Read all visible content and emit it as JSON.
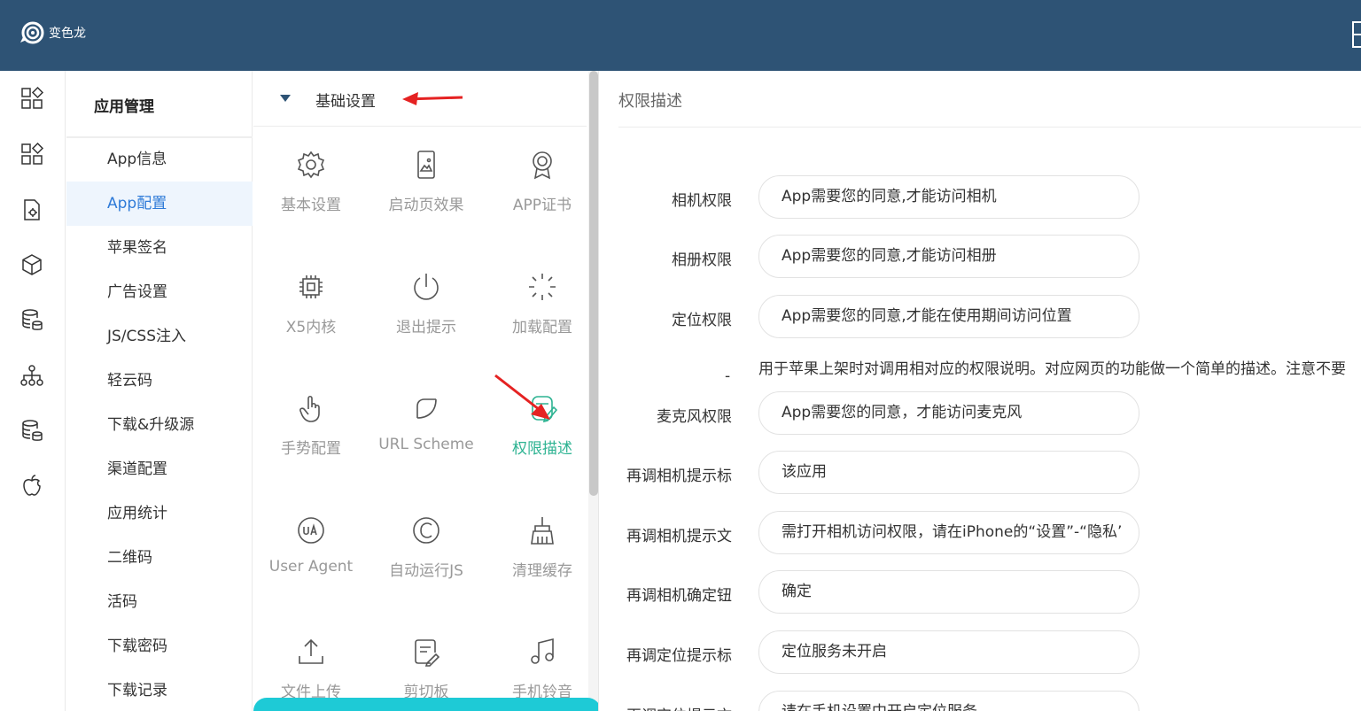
{
  "app": {
    "logo_text": "变色龙"
  },
  "colors": {
    "header_bg": "#2e5375",
    "accent_blue": "#2f7bd8",
    "accent_green": "#2db392",
    "bottom_bar": "#1ecad6"
  },
  "rail": {
    "icons": [
      "apps-icon",
      "apps-icon",
      "document-settings-icon",
      "cube-icon",
      "database-icon",
      "sitemap-icon",
      "database-icon",
      "apple-icon"
    ]
  },
  "subnav": {
    "title": "应用管理",
    "items": [
      "App信息",
      "App配置",
      "苹果签名",
      "广告设置",
      "JS/CSS注入",
      "轻云码",
      "下载&升级源",
      "渠道配置",
      "应用统计",
      "二维码",
      "活码",
      "下载密码",
      "下载记录"
    ],
    "active_index": 1
  },
  "features": {
    "section_label": "基础设置",
    "tiles": [
      {
        "label": "基本设置",
        "icon": "gear-icon"
      },
      {
        "label": "启动页效果",
        "icon": "phone-image-icon"
      },
      {
        "label": "APP证书",
        "icon": "certificate-icon"
      },
      {
        "label": "X5内核",
        "icon": "chip-icon"
      },
      {
        "label": "退出提示",
        "icon": "power-icon"
      },
      {
        "label": "加载配置",
        "icon": "loading-icon"
      },
      {
        "label": "手势配置",
        "icon": "hand-pointer-icon"
      },
      {
        "label": "URL Scheme",
        "icon": "link-c-icon"
      },
      {
        "label": "权限描述",
        "icon": "edit-shield-icon"
      },
      {
        "label": "User Agent",
        "icon": "ua-icon"
      },
      {
        "label": "自动运行JS",
        "icon": "copyright-icon"
      },
      {
        "label": "清理缓存",
        "icon": "broom-icon"
      },
      {
        "label": "文件上传",
        "icon": "upload-icon"
      },
      {
        "label": "剪切板",
        "icon": "clipboard-edit-icon"
      },
      {
        "label": "手机铃音",
        "icon": "music-icon"
      }
    ],
    "active_index": 8
  },
  "permissions": {
    "title": "权限描述",
    "fields": [
      {
        "label": "相机权限",
        "value": "App需要您的同意,才能访问相机"
      },
      {
        "label": "相册权限",
        "value": "App需要您的同意,才能访问相册"
      },
      {
        "label": "定位权限",
        "value": "App需要您的同意,才能在使用期间访问位置"
      },
      {
        "label": "麦克风权限",
        "value": "App需要您的同意，才能访问麦克风"
      },
      {
        "label": "再调相机提示标",
        "value": "该应用"
      },
      {
        "label": "再调相机提示文",
        "value": "需打开相机访问权限，请在iPhone的“设置”-“隐私’"
      },
      {
        "label": "再调相机确定钮",
        "value": "确定"
      },
      {
        "label": "再调定位提示标",
        "value": "定位服务未开启"
      },
      {
        "label": "再调定位提示文",
        "value": "请在手机设置中开启定位服务"
      }
    ],
    "help_dash": "-",
    "help_text": "用于苹果上架时对调用相对应的权限说明。对应网页的功能做一个简单的描述。注意不要"
  }
}
